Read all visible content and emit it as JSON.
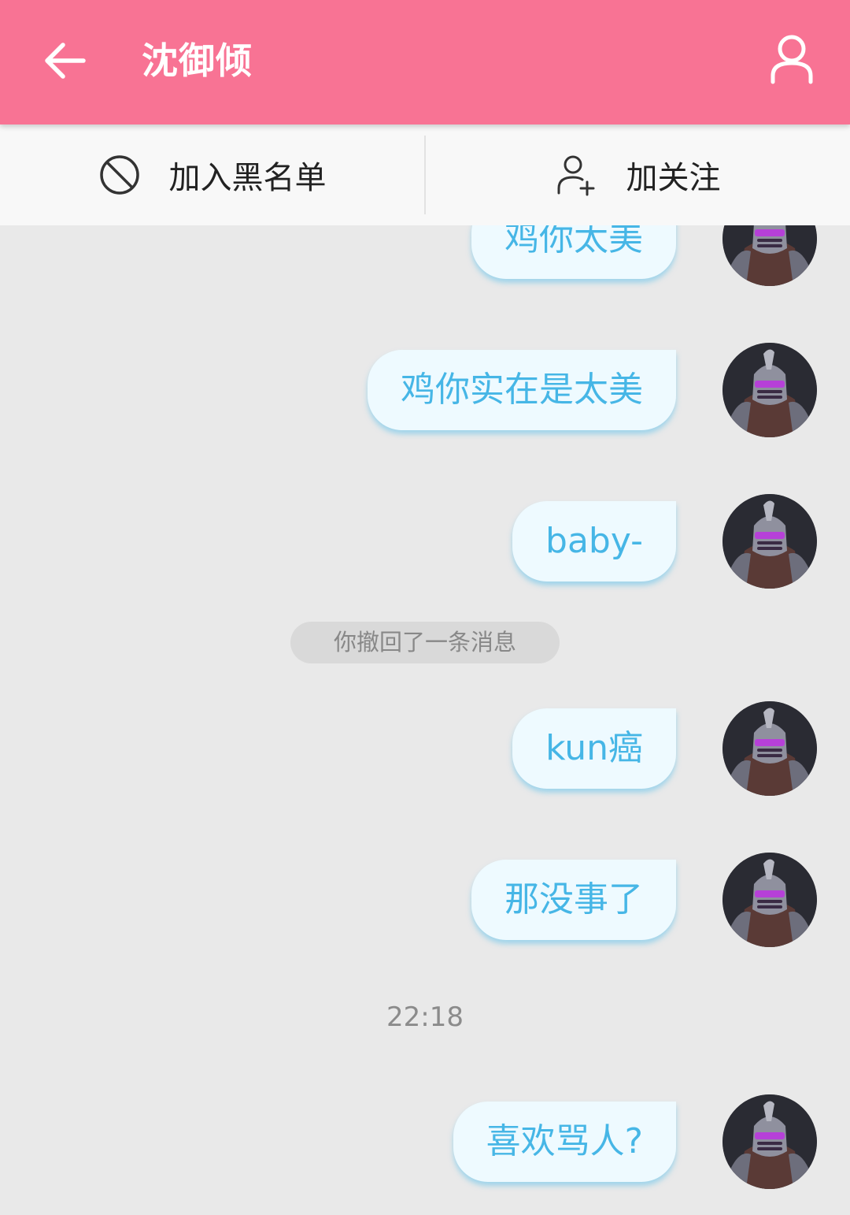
{
  "header": {
    "title": "沈御倾"
  },
  "actions": {
    "blacklist_label": "加入黑名单",
    "follow_label": "加关注"
  },
  "messages": [
    {
      "text": "鸡你太美"
    },
    {
      "text": "鸡你实在是太美"
    },
    {
      "text": "baby-"
    },
    {
      "text": "kun癌"
    },
    {
      "text": "那没事了"
    },
    {
      "text": "喜欢骂人?"
    }
  ],
  "system": {
    "recall_notice": "你撤回了一条消息",
    "timestamp": "22:18"
  },
  "colors": {
    "appbar": "#f87394",
    "bubble_text": "#46b6e6",
    "bubble_bg": "#eefaff"
  }
}
